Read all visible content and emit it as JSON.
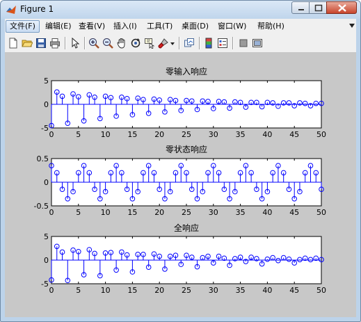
{
  "window": {
    "title": "Figure 1"
  },
  "menu": [
    "文件(F)",
    "编辑(E)",
    "查看(V)",
    "插入(I)",
    "工具(T)",
    "桌面(D)",
    "窗口(W)",
    "帮助(H)"
  ],
  "toolbar_icons": [
    "new-figure-icon",
    "open-file-icon",
    "save-icon",
    "print-icon",
    "pointer-icon",
    "zoom-in-icon",
    "zoom-out-icon",
    "pan-icon",
    "rotate-icon",
    "data-cursor-icon",
    "brush-icon",
    "brush-dropdown-icon",
    "link-plot-icon",
    "colorbar-icon",
    "legend-icon",
    "hide-plot-tools-icon",
    "show-plot-tools-icon"
  ],
  "colors": {
    "stem": "#0000ff",
    "axes_bg": "#ffffff",
    "figure_bg": "#c8c8c8"
  },
  "chart_data": [
    {
      "type": "stem",
      "title": "零输入响应",
      "xlim": [
        0,
        50
      ],
      "ylim": [
        -5,
        5
      ],
      "xticks": [
        0,
        5,
        10,
        15,
        20,
        25,
        30,
        35,
        40,
        45,
        50
      ],
      "yticks": [
        -5,
        0,
        5
      ],
      "x": [
        0,
        1,
        2,
        3,
        4,
        5,
        6,
        7,
        8,
        9,
        10,
        11,
        12,
        13,
        14,
        15,
        16,
        17,
        18,
        19,
        20,
        21,
        22,
        23,
        24,
        25,
        26,
        27,
        28,
        29,
        30,
        31,
        32,
        33,
        34,
        35,
        36,
        37,
        38,
        39,
        40,
        41,
        42,
        43,
        44,
        45,
        46,
        47,
        48,
        49,
        50
      ],
      "y": [
        -4.5,
        2.6,
        1.7,
        -4.0,
        2.2,
        1.6,
        -3.5,
        2.0,
        1.5,
        -3.0,
        1.7,
        1.4,
        -2.5,
        1.5,
        1.2,
        -2.2,
        1.3,
        1.0,
        -1.9,
        1.1,
        0.9,
        -1.6,
        1.0,
        0.8,
        -1.3,
        0.8,
        0.7,
        -1.1,
        0.7,
        0.6,
        -0.9,
        0.6,
        0.5,
        -0.8,
        0.5,
        0.4,
        -0.6,
        0.4,
        0.4,
        -0.5,
        0.4,
        0.3,
        -0.4,
        0.3,
        0.3,
        -0.3,
        0.3,
        0.2,
        -0.3,
        0.2,
        0.2
      ]
    },
    {
      "type": "stem",
      "title": "零状态响应",
      "xlim": [
        0,
        50
      ],
      "ylim": [
        -0.5,
        0.5
      ],
      "xticks": [
        0,
        5,
        10,
        15,
        20,
        25,
        30,
        35,
        40,
        45,
        50
      ],
      "yticks": [
        -0.5,
        0,
        0.5
      ],
      "x": [
        0,
        1,
        2,
        3,
        4,
        5,
        6,
        7,
        8,
        9,
        10,
        11,
        12,
        13,
        14,
        15,
        16,
        17,
        18,
        19,
        20,
        21,
        22,
        23,
        24,
        25,
        26,
        27,
        28,
        29,
        30,
        31,
        32,
        33,
        34,
        35,
        36,
        37,
        38,
        39,
        40,
        41,
        42,
        43,
        44,
        45,
        46,
        47,
        48,
        49,
        50
      ],
      "y": [
        0.35,
        0.2,
        -0.15,
        -0.35,
        -0.2,
        0.2,
        0.35,
        0.2,
        -0.15,
        -0.35,
        -0.2,
        0.2,
        0.35,
        0.2,
        -0.15,
        -0.35,
        -0.2,
        0.2,
        0.35,
        0.2,
        -0.15,
        -0.35,
        -0.2,
        0.2,
        0.35,
        0.2,
        -0.15,
        -0.35,
        -0.2,
        0.2,
        0.35,
        0.2,
        -0.15,
        -0.35,
        -0.2,
        0.2,
        0.35,
        0.2,
        -0.15,
        -0.35,
        -0.2,
        0.2,
        0.35,
        0.2,
        -0.15,
        -0.35,
        -0.2,
        0.2,
        0.35,
        0.2,
        -0.15
      ]
    },
    {
      "type": "stem",
      "title": "全响应",
      "xlim": [
        0,
        50
      ],
      "ylim": [
        -5,
        5
      ],
      "xticks": [
        0,
        5,
        10,
        15,
        20,
        25,
        30,
        35,
        40,
        45,
        50
      ],
      "yticks": [
        -5,
        0,
        5
      ],
      "x": [
        0,
        1,
        2,
        3,
        4,
        5,
        6,
        7,
        8,
        9,
        10,
        11,
        12,
        13,
        14,
        15,
        16,
        17,
        18,
        19,
        20,
        21,
        22,
        23,
        24,
        25,
        26,
        27,
        28,
        29,
        30,
        31,
        32,
        33,
        34,
        35,
        36,
        37,
        38,
        39,
        40,
        41,
        42,
        43,
        44,
        45,
        46,
        47,
        48,
        49,
        50
      ],
      "y": [
        -4.2,
        2.9,
        1.7,
        -4.3,
        2.1,
        1.8,
        -3.1,
        2.2,
        1.4,
        -3.3,
        1.5,
        1.6,
        -2.1,
        1.7,
        1.1,
        -2.5,
        1.2,
        1.2,
        -1.5,
        1.3,
        0.8,
        -1.9,
        0.8,
        1.0,
        -0.9,
        1.0,
        0.6,
        -1.4,
        0.5,
        0.8,
        -0.6,
        0.8,
        0.4,
        -1.1,
        0.3,
        0.6,
        -0.3,
        0.6,
        0.3,
        -0.8,
        0.2,
        0.5,
        -0.1,
        0.5,
        0.2,
        -0.6,
        0.1,
        0.4,
        0.1,
        0.4,
        0.1
      ]
    }
  ]
}
